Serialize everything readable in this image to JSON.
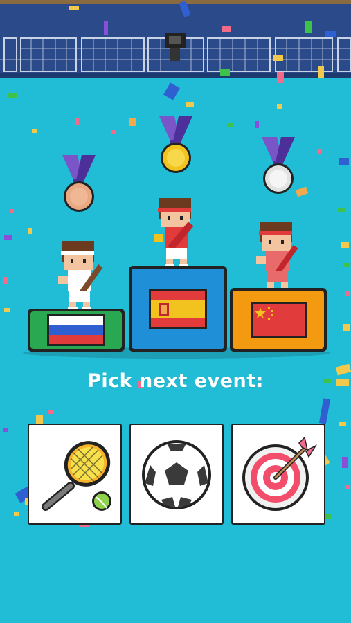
{
  "screen": "podium-results",
  "prompt_text": "Pick next event:",
  "colors": {
    "background": "#21bdd6",
    "stands": "#2a4a8a",
    "podium_first": "#1f8fd8",
    "podium_second": "#2aa851",
    "podium_third": "#f39a11"
  },
  "podium": [
    {
      "place": 1,
      "medal": "gold",
      "flag": "spain-flag"
    },
    {
      "place": 2,
      "medal": "bronze",
      "flag": "russia-flag"
    },
    {
      "place": 3,
      "medal": "silver",
      "flag": "china-flag"
    }
  ],
  "events": [
    {
      "id": "tennis",
      "icon": "tennis-racket-icon"
    },
    {
      "id": "soccer",
      "icon": "soccer-ball-icon"
    },
    {
      "id": "archery",
      "icon": "target-icon"
    }
  ]
}
